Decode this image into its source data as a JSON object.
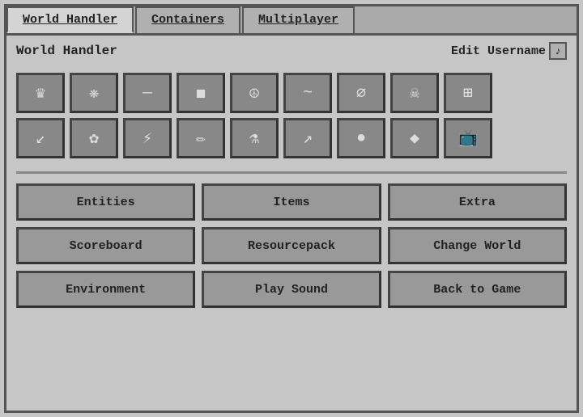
{
  "tabs": [
    {
      "label": "World Handler",
      "active": true
    },
    {
      "label": "Containers",
      "active": false
    },
    {
      "label": "Multiplayer",
      "active": false
    }
  ],
  "header": {
    "title": "World Handler",
    "edit_username_label": "Edit Username",
    "edit_username_icon": "♪"
  },
  "icon_rows": [
    [
      {
        "symbol": "♛",
        "name": "crown"
      },
      {
        "symbol": "❊",
        "name": "snowflake"
      },
      {
        "symbol": "—",
        "name": "dash"
      },
      {
        "symbol": "◼",
        "name": "square"
      },
      {
        "symbol": "☮",
        "name": "peace"
      },
      {
        "symbol": "~",
        "name": "tilde"
      },
      {
        "symbol": "∅",
        "name": "empty-set"
      },
      {
        "symbol": "☠",
        "name": "skull"
      },
      {
        "symbol": "⊞",
        "name": "grid"
      }
    ],
    [
      {
        "symbol": "↙",
        "name": "arrow-down-left"
      },
      {
        "symbol": "✿",
        "name": "flower"
      },
      {
        "symbol": "⚡",
        "name": "lightning"
      },
      {
        "symbol": "✏",
        "name": "pencil"
      },
      {
        "symbol": "⚗",
        "name": "flask"
      },
      {
        "symbol": "↗",
        "name": "arrow-up-right"
      },
      {
        "symbol": "●",
        "name": "circle"
      },
      {
        "symbol": "◆",
        "name": "diamond"
      },
      {
        "symbol": "📺",
        "name": "tv"
      }
    ]
  ],
  "action_rows": [
    [
      {
        "label": "Entities",
        "name": "entities-button"
      },
      {
        "label": "Items",
        "name": "items-button"
      },
      {
        "label": "Extra",
        "name": "extra-button"
      }
    ],
    [
      {
        "label": "Scoreboard",
        "name": "scoreboard-button"
      },
      {
        "label": "Resourcepack",
        "name": "resourcepack-button"
      },
      {
        "label": "Change World",
        "name": "change-world-button"
      }
    ],
    [
      {
        "label": "Environment",
        "name": "environment-button"
      },
      {
        "label": "Play Sound",
        "name": "play-sound-button"
      },
      {
        "label": "Back to Game",
        "name": "back-to-game-button"
      }
    ]
  ]
}
